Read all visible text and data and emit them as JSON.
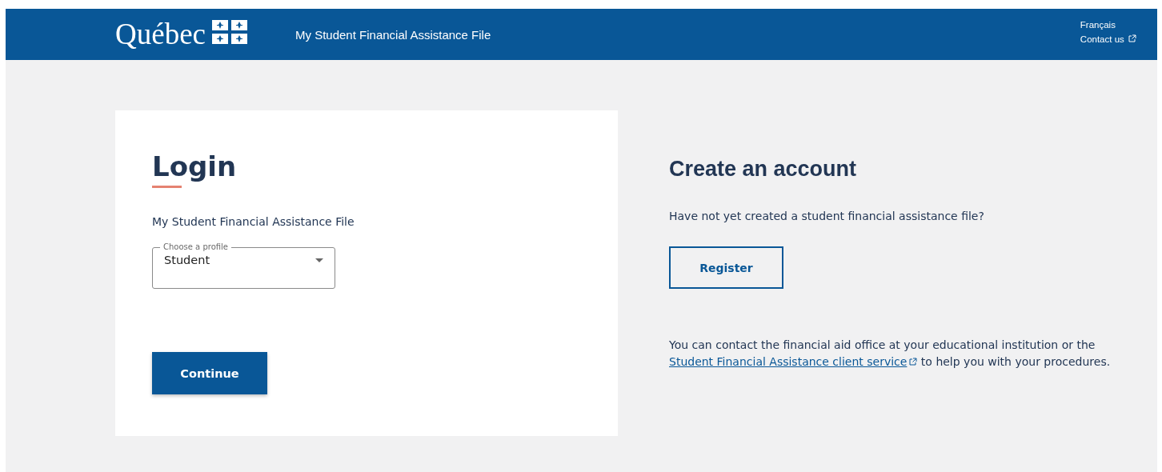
{
  "header": {
    "logo": "Québec",
    "title": "My Student Financial Assistance File",
    "language_link": "Français",
    "contact_link": "Contact us"
  },
  "login": {
    "title": "Login",
    "subtitle": "My Student Financial Assistance File",
    "profile_field": {
      "label": "Choose a profile",
      "value": "Student"
    },
    "button": "Continue"
  },
  "signup": {
    "title": "Create an account",
    "question": "Have not yet created a student financial assistance file?",
    "button": "Register",
    "help": {
      "before": "You can contact the financial aid office at your educational institution or the",
      "link": "Student Financial Assistance client service",
      "after": "to help you with your procedures."
    }
  }
}
